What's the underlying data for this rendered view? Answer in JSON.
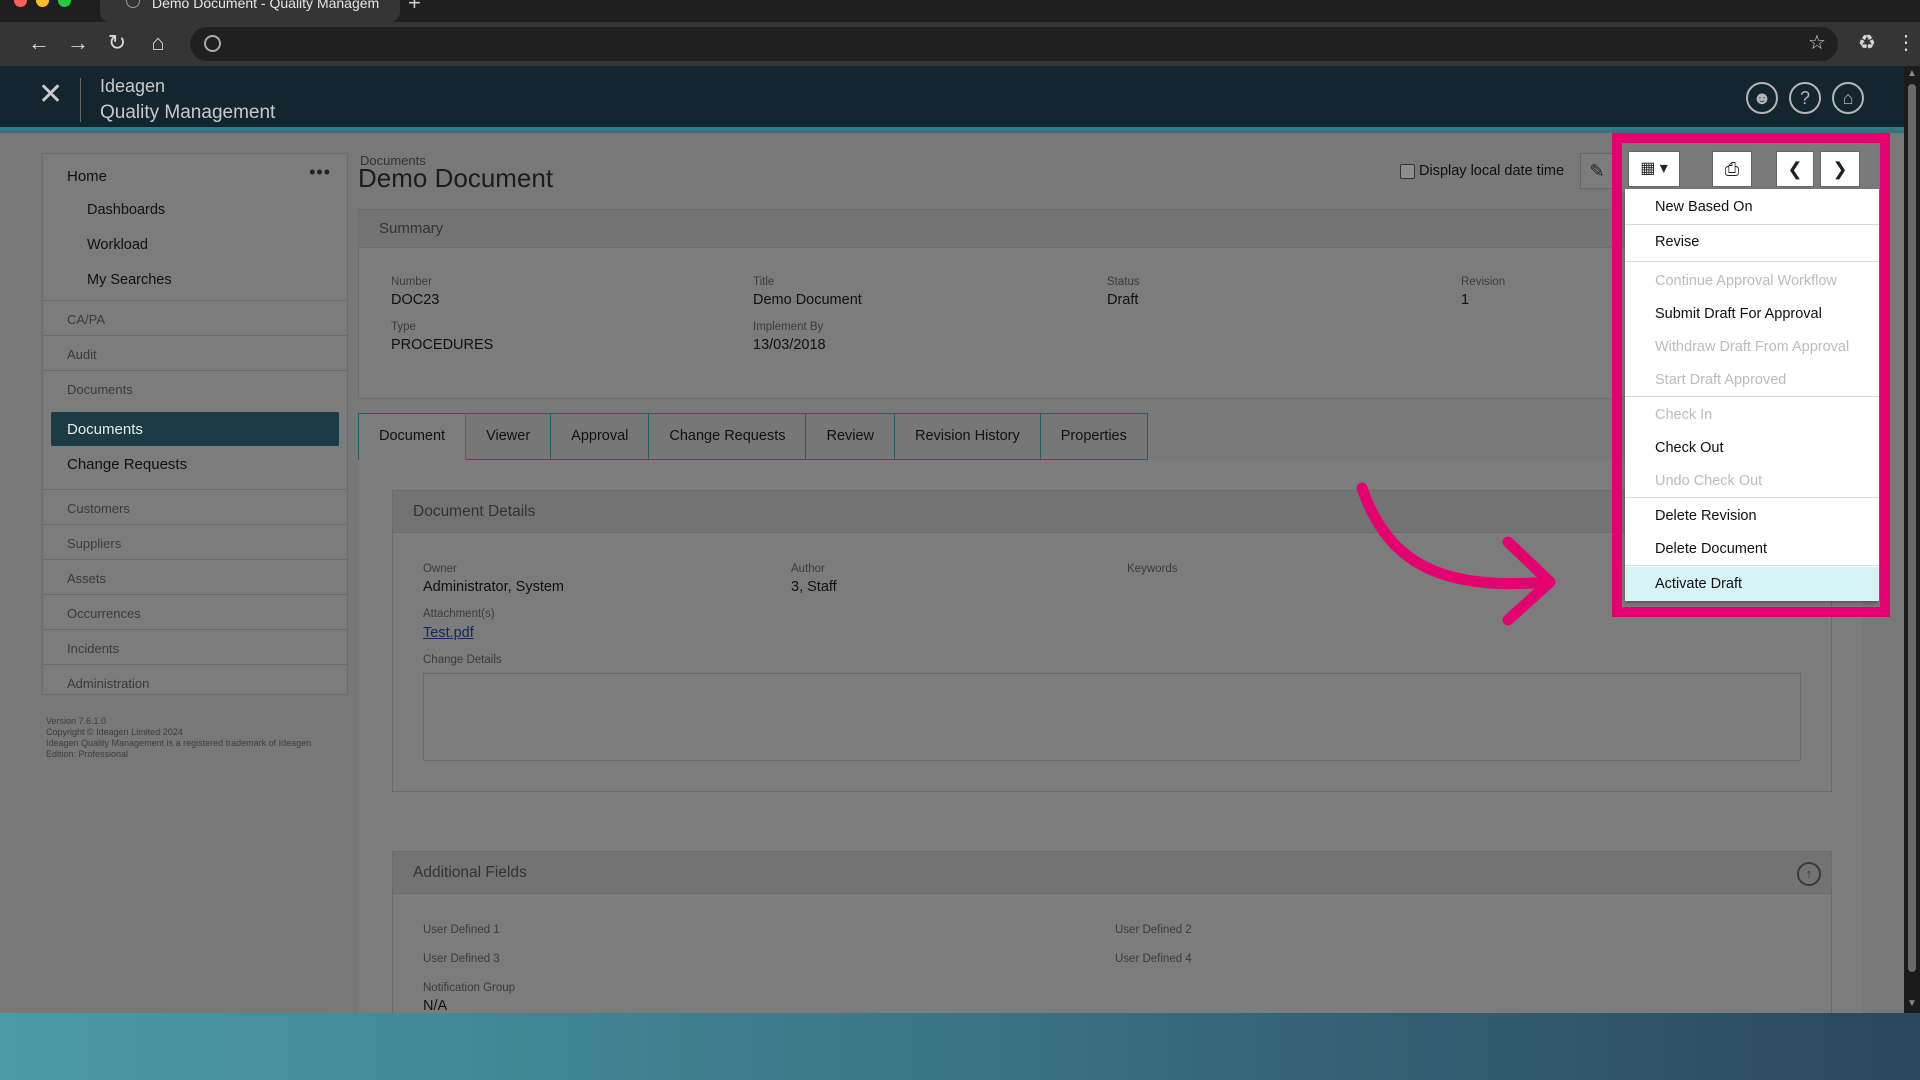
{
  "browser": {
    "tab_title": "Demo Document - Quality Managem",
    "new_tab_symbol": "+",
    "colors": {
      "close": "#ff5f57",
      "minimize": "#febc2e",
      "maximize": "#28c840"
    }
  },
  "header": {
    "brand_name": "Ideagen",
    "product_name": "Quality Management",
    "icons": [
      "user-icon",
      "help-icon",
      "home-icon"
    ]
  },
  "sidebar": {
    "home_label": "Home",
    "home_subitems": [
      "Dashboards",
      "Workload",
      "My Searches"
    ],
    "sections": [
      "CA/PA",
      "Audit",
      "Documents"
    ],
    "active_item": "Documents",
    "change_requests": "Change Requests",
    "more_sections": [
      "Customers",
      "Suppliers",
      "Assets",
      "Occurrences",
      "Incidents",
      "Administration"
    ],
    "footer": {
      "version": "Version 7.6.1.0",
      "copyright": "Copyright © Ideagen Limited 2024",
      "trademark": "Ideagen Quality Management is a registered trademark of Ideagen",
      "edition": "Edition: Professional"
    }
  },
  "page": {
    "breadcrumb": "Documents",
    "title": "Demo Document",
    "local_date_label": "Display local date time"
  },
  "summary": {
    "heading": "Summary",
    "number_label": "Number",
    "number": "DOC23",
    "title_label": "Title",
    "title": "Demo Document",
    "status_label": "Status",
    "status": "Draft",
    "revision_label": "Revision",
    "revision": "1",
    "type_label": "Type",
    "type": "PROCEDURES",
    "implement_label": "Implement By",
    "implement_by": "13/03/2018"
  },
  "tabs": [
    "Document",
    "Viewer",
    "Approval",
    "Change Requests",
    "Review",
    "Revision History",
    "Properties"
  ],
  "document_details": {
    "heading": "Document Details",
    "owner_label": "Owner",
    "owner": "Administrator, System",
    "author_label": "Author",
    "author": "3, Staff",
    "keywords_label": "Keywords",
    "attachments_label": "Attachment(s)",
    "attachment": "Test.pdf",
    "change_details_label": "Change Details"
  },
  "additional_fields": {
    "heading": "Additional Fields",
    "ud1": "User Defined 1",
    "ud2": "User Defined 2",
    "ud3": "User Defined 3",
    "ud4": "User Defined 4",
    "notification_label": "Notification Group",
    "notification": "N/A"
  },
  "action_menu": {
    "items": [
      {
        "label": "New Based On",
        "enabled": true
      },
      {
        "label": "Revise",
        "enabled": true
      },
      {
        "label": "Continue Approval Workflow",
        "enabled": false
      },
      {
        "label": "Submit Draft For Approval",
        "enabled": true
      },
      {
        "label": "Withdraw Draft From Approval",
        "enabled": false
      },
      {
        "label": "Start Draft Approved",
        "enabled": false
      },
      {
        "label": "Check In",
        "enabled": false
      },
      {
        "label": "Check Out",
        "enabled": true
      },
      {
        "label": "Undo Check Out",
        "enabled": false
      },
      {
        "label": "Delete Revision",
        "enabled": true
      },
      {
        "label": "Delete Document",
        "enabled": true
      },
      {
        "label": "Activate Draft",
        "enabled": true,
        "highlighted": true
      }
    ],
    "highlight_color": "#e5006f"
  }
}
